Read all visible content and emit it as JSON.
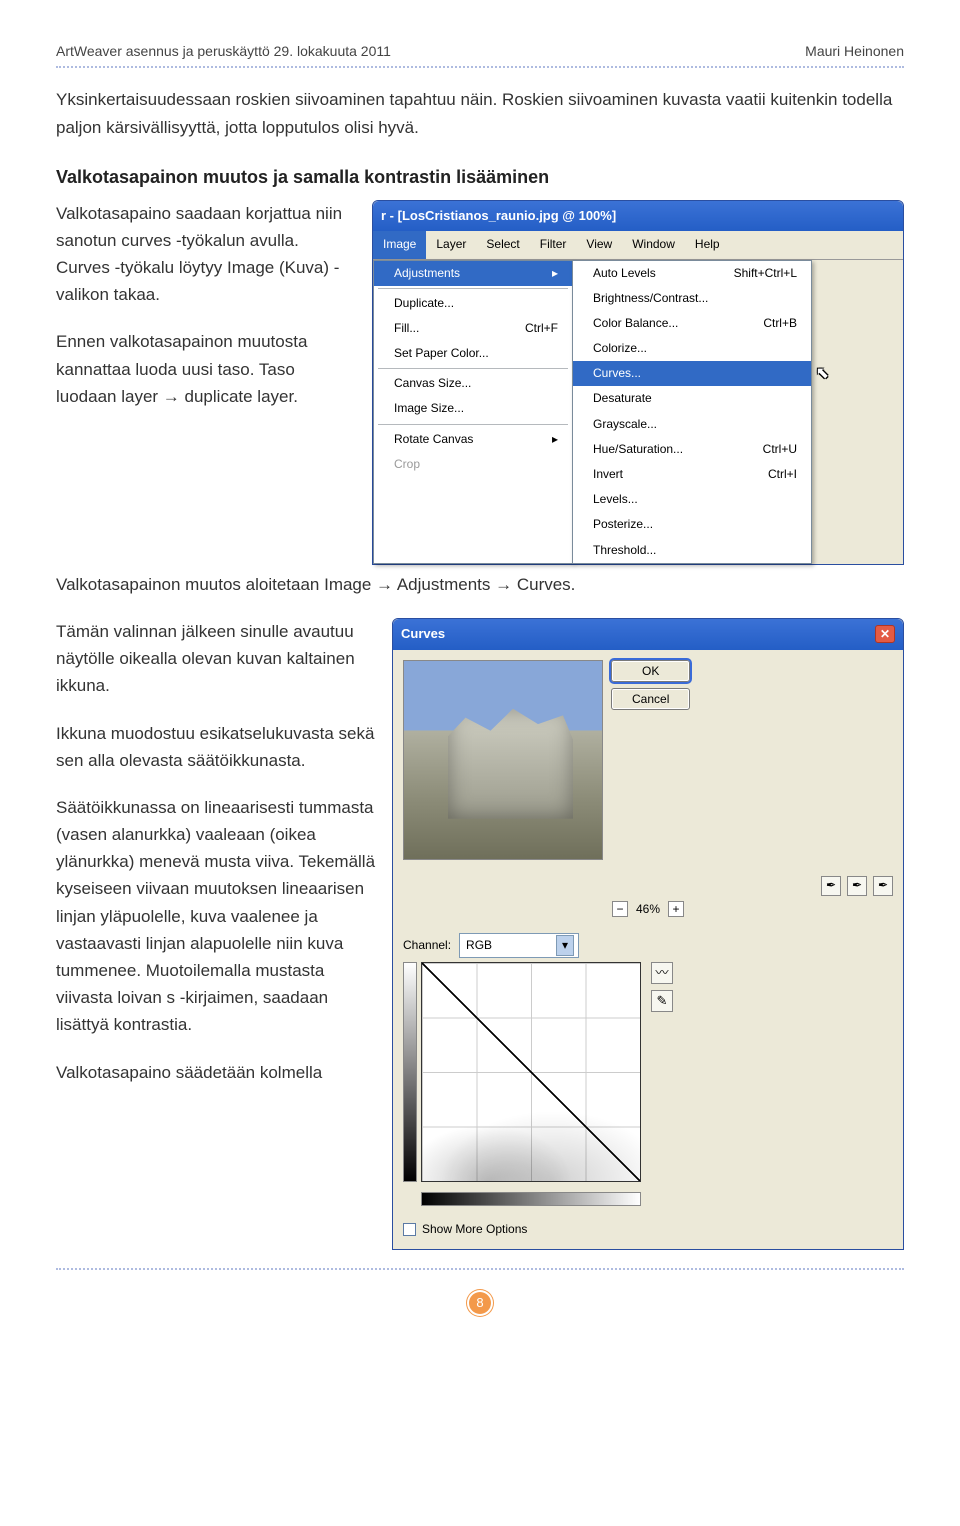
{
  "header": {
    "left": "ArtWeaver asennus ja peruskäyttö   29. lokakuuta 2011",
    "right": "Mauri Heinonen"
  },
  "body": {
    "intro": "Yksinkertaisuudessaan roskien siivoaminen tapahtuu näin. Roskien siivoaminen kuvasta vaatii kuitenkin todella paljon kärsivällisyyttä, jotta lopputulos olisi hyvä.",
    "heading2": "Valkotasapainon muutos ja samalla kontrastin lisääminen",
    "p2": "Valkotasapaino saadaan korjattua niin sanotun curves -työkalun avulla. Curves -työkalu löytyy Image (Kuva) -valikon takaa.",
    "p3": "Ennen valkotasapainon muutosta kannattaa luoda uusi taso. Taso luodaan layer → duplicate layer.",
    "p4": "Valkotasapainon muutos aloitetaan Image → Adjustments → Curves.",
    "p5": "Tämän valinnan jälkeen sinulle avautuu näytölle oikealla olevan kuvan kaltainen ikkuna.",
    "p6": "Ikkuna muodostuu esikatselukuvasta sekä sen alla olevasta säätöikkunasta.",
    "p7": "Säätöikkunassa on lineaarisesti tummasta (vasen alanurkka) vaaleaan (oikea ylänurkka) menevä musta viiva. Tekemällä kyseiseen viivaan muutoksen lineaarisen linjan yläpuolelle, kuva vaalenee ja vastaavasti linjan alapuolelle niin kuva tummenee. Muotoilemalla mustasta viivasta loivan s -kirjaimen, saadaan lisättyä kontrastia.",
    "p8": "Valkotasapaino säädetään kolmella"
  },
  "app1": {
    "title": "r - [LosCristianos_raunio.jpg @ 100%]",
    "menubar": [
      "Image",
      "Layer",
      "Select",
      "Filter",
      "View",
      "Window",
      "Help"
    ],
    "imageMenu": {
      "adjustments": "Adjustments",
      "duplicate": "Duplicate...",
      "fill": "Fill...",
      "fill_sc": "Ctrl+F",
      "setpaper": "Set Paper Color...",
      "canvassize": "Canvas Size...",
      "imagesize": "Image Size...",
      "rotate": "Rotate Canvas",
      "crop": "Crop"
    },
    "adjustmentsMenu": {
      "autolevels": "Auto Levels",
      "autolevels_sc": "Shift+Ctrl+L",
      "brightness": "Brightness/Contrast...",
      "colorbalance": "Color Balance...",
      "colorbalance_sc": "Ctrl+B",
      "colorize": "Colorize...",
      "curves": "Curves...",
      "desaturate": "Desaturate",
      "grayscale": "Grayscale...",
      "huesat": "Hue/Saturation...",
      "huesat_sc": "Ctrl+U",
      "invert": "Invert",
      "invert_sc": "Ctrl+I",
      "levels": "Levels...",
      "posterize": "Posterize...",
      "threshold": "Threshold..."
    }
  },
  "curvesDialog": {
    "title": "Curves",
    "ok": "OK",
    "cancel": "Cancel",
    "zoom": "46%",
    "channelLabel": "Channel:",
    "channelValue": "RGB",
    "showMore": "Show More Options"
  },
  "page_number": "8"
}
